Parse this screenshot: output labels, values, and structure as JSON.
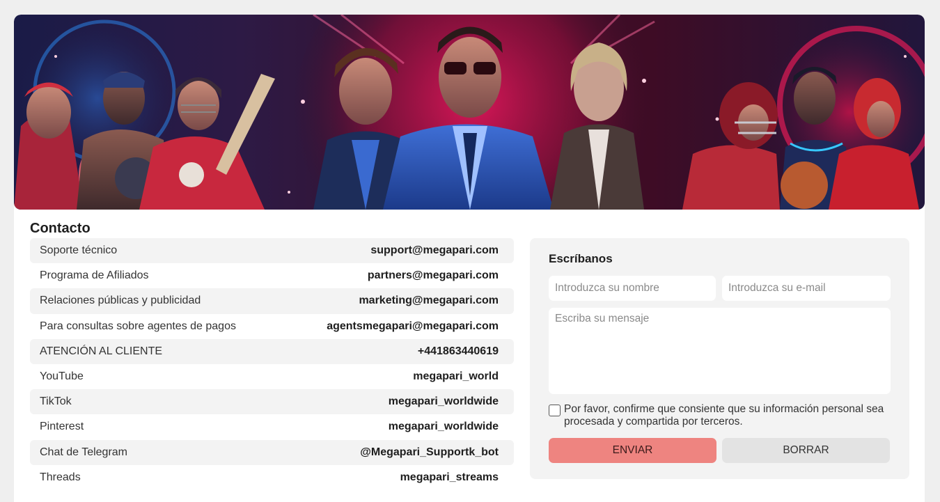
{
  "contact": {
    "title": "Contacto",
    "rows": [
      {
        "label": "Soporte técnico",
        "value": "support@megapari.com"
      },
      {
        "label": "Programa de Afiliados",
        "value": "partners@megapari.com"
      },
      {
        "label": "Relaciones públicas y publicidad",
        "value": "marketing@megapari.com"
      },
      {
        "label": "Para consultas sobre agentes de pagos",
        "value": "agentsmegapari@megapari.com"
      },
      {
        "label": "ATENCIÓN AL CLIENTE",
        "value": "+441863440619"
      },
      {
        "label": "YouTube",
        "value": "megapari_world"
      },
      {
        "label": "TikTok",
        "value": "megapari_worldwide"
      },
      {
        "label": "Pinterest",
        "value": "megapari_worldwide"
      },
      {
        "label": "Chat de Telegram",
        "value": "@Megapari_Supportk_bot"
      },
      {
        "label": "Threads",
        "value": "megapari_streams"
      }
    ]
  },
  "form": {
    "title": "Escríbanos",
    "name_placeholder": "Introduzca su nombre",
    "email_placeholder": "Introduzca su e-mail",
    "message_placeholder": "Escriba su mensaje",
    "consent_text": "Por favor, confirme que consiente que su información personal sea procesada y compartida por terceros.",
    "consent_checked": false,
    "send_label": "ENVIAR",
    "clear_label": "BORRAR"
  },
  "colors": {
    "accent": "#ee8480",
    "row_alt": "#f3f3f3",
    "banner_glow": "#c8134a"
  }
}
